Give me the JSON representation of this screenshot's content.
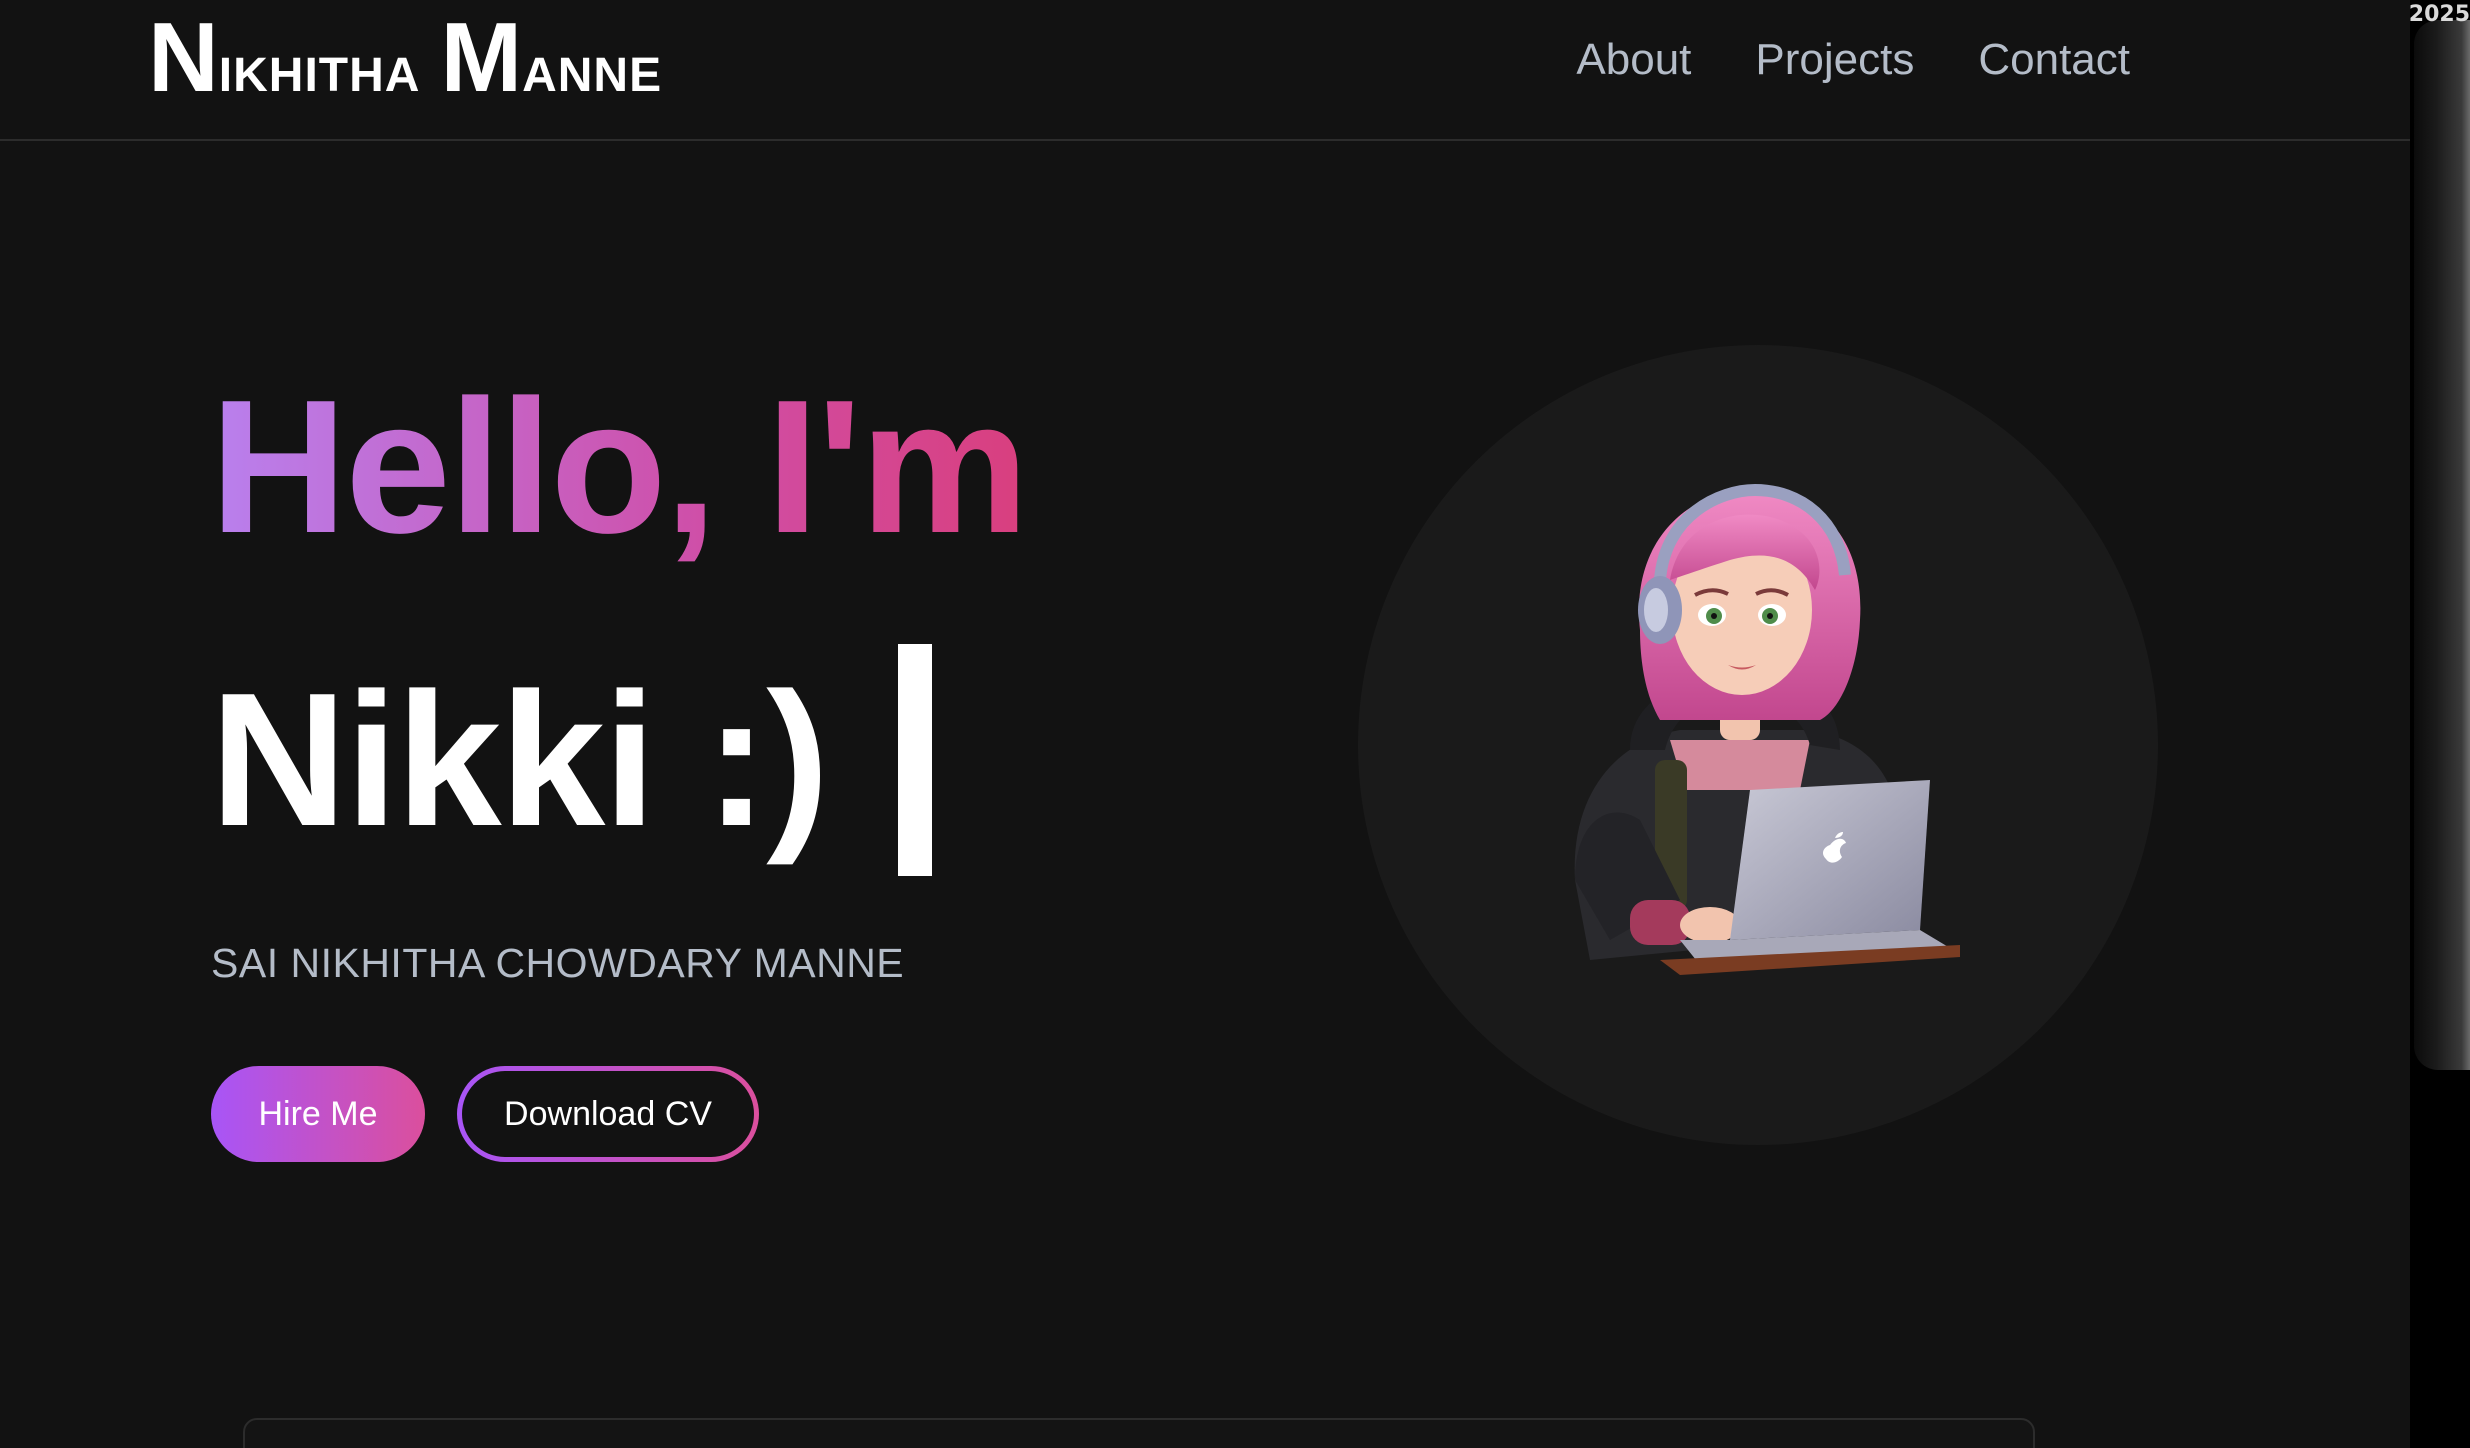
{
  "header": {
    "logo": {
      "first_initial": "N",
      "first_rest": "IKHITHA",
      "last_initial": "M",
      "last_rest": "ANNE"
    },
    "nav": [
      "About",
      "Projects",
      "Contact"
    ]
  },
  "hero": {
    "greeting": "Hello, I'm",
    "typed_name": "Nikki :)",
    "full_name": "SAI NIKHITHA CHOWDARY MANNE",
    "buttons": {
      "hire": "Hire Me",
      "cv": "Download CV"
    }
  },
  "avatar": {
    "icon": "girl-with-laptop-avatar"
  },
  "side_window": {
    "year_fragment": "2025"
  },
  "colors": {
    "background": "#121212",
    "gradient_start": "#a855f7",
    "gradient_end": "#db4f9d",
    "nav_text": "#b4bcc8"
  }
}
